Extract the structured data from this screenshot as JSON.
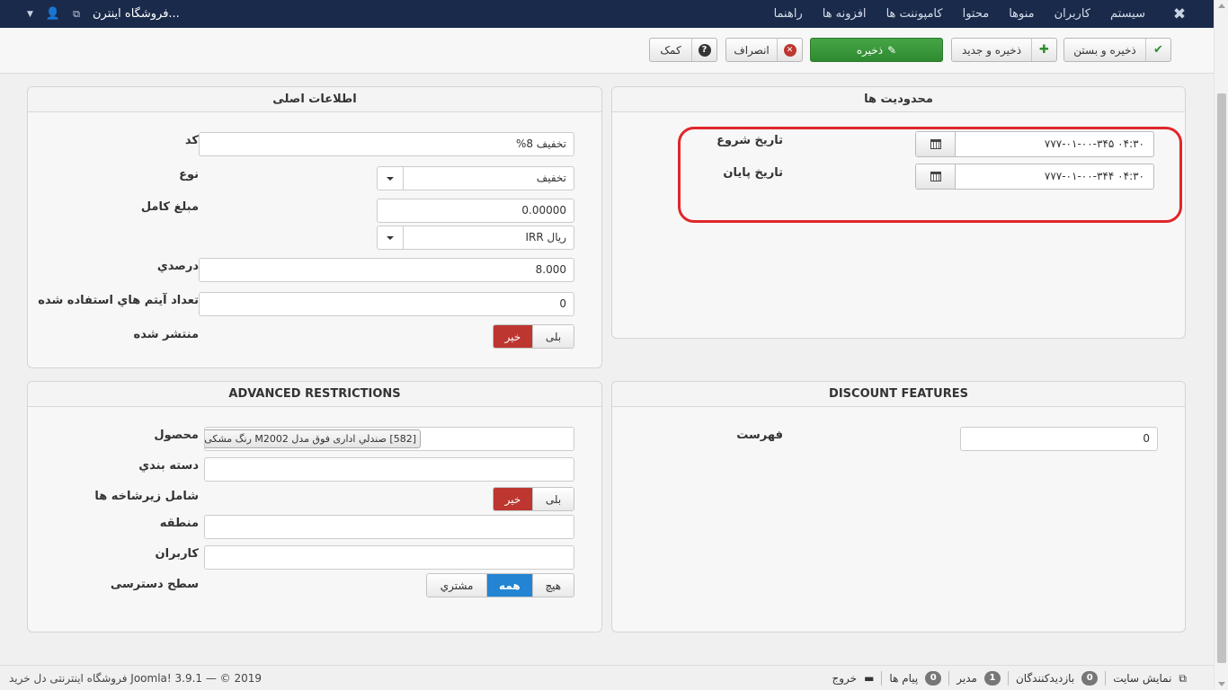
{
  "navbar": {
    "menu": [
      "سیستم",
      "کاربران",
      "منوها",
      "محتوا",
      "کامپوننت ها",
      "افزونه ها",
      "راهنما"
    ],
    "site_name": "فروشگاه اینترن..."
  },
  "toolbar": {
    "save_close": "ذخیره و بستن",
    "save_new": "ذخیره و جدید",
    "save": "ذخیره",
    "cancel": "انصراف",
    "help": "کمک"
  },
  "main_info": {
    "title": "اطلاعات اصلی",
    "code_label": "کد",
    "code_value": "تخفیف 8%",
    "type_label": "نوع",
    "type_value": "تخفیف",
    "amount_label": "مبلغ کامل",
    "amount_value": "0.00000",
    "currency_value": "ریال IRR",
    "percent_label": "درصدي",
    "percent_value": "8.000",
    "used_label": "تعداد آیتم هاي استفاده شده",
    "used_value": "0",
    "published_label": "منتشر شده",
    "yes": "بلی",
    "no": "خیر"
  },
  "restrictions": {
    "title": "محدودیت ها",
    "start_label": "تاریخ شروع",
    "start_value": "۰۴:۳۰ ۷۷۷-۰۱-۰۰-۳۴۵",
    "end_label": "تاریخ پایان",
    "end_value": "۰۴:۳۰ ۷۷۷-۰۱-۰۰-۳۴۴"
  },
  "advanced": {
    "title": "ADVANCED RESTRICTIONS",
    "product_label": "محصول",
    "product_tag": "[582] صندلي اداری فوق مدل M2002 رنگ مشکی",
    "category_label": "دسته بندي",
    "include_sub_label": "شامل زیرشاخه ها",
    "yes": "بلی",
    "no": "خیر",
    "region_label": "منطقه",
    "users_label": "کاربران",
    "access_label": "سطح دسترسی",
    "access_none": "هیچ",
    "access_all": "همه",
    "access_customer": "مشتري"
  },
  "features": {
    "title": "DISCOUNT FEATURES",
    "order_label": "فهرست",
    "order_value": "0"
  },
  "footer": {
    "view_site": "نمایش سایت",
    "visitors_count": "0",
    "visitors_label": "بازدیدکنندگان",
    "admin_count": "1",
    "admin_label": "مدیر",
    "messages_count": "0",
    "messages_label": "پیام ها",
    "logout": "خروج",
    "copyright": "فروشگاه اینترنتی دل خرید Joomla! 3.9.1 — © 2019"
  }
}
